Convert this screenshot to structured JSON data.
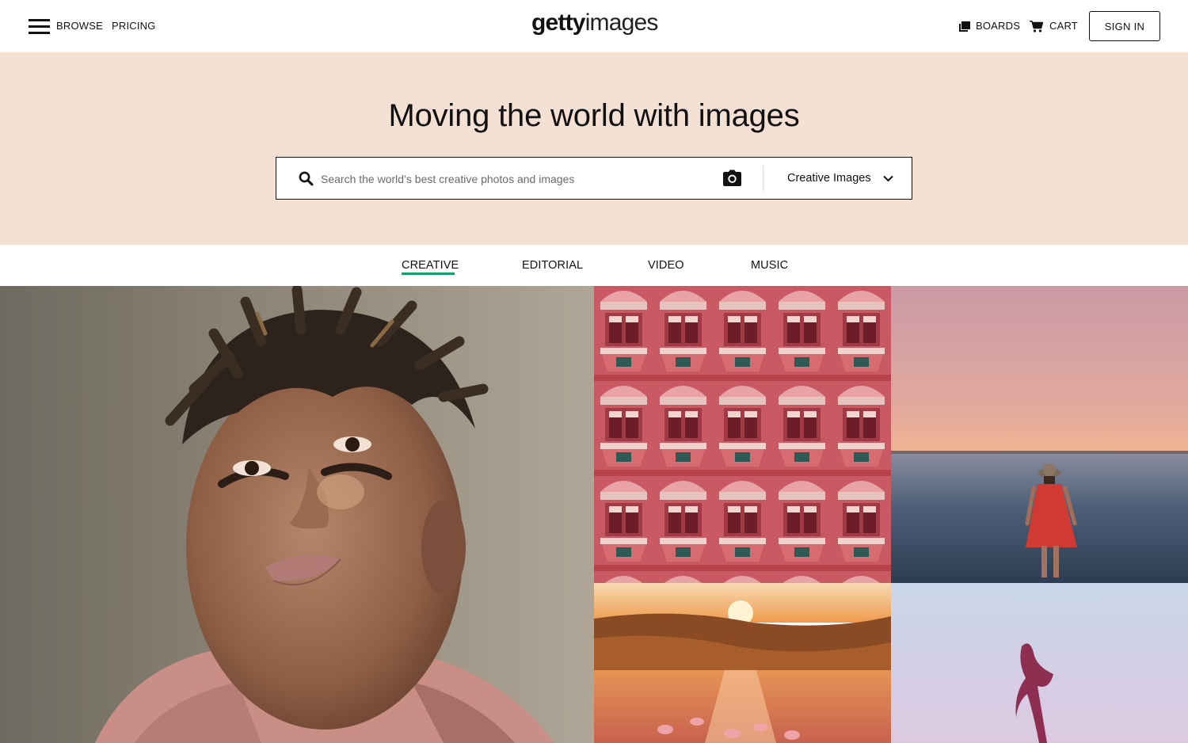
{
  "header": {
    "browse_label": "BROWSE",
    "pricing_label": "PRICING",
    "logo": {
      "bold": "getty",
      "light": "images"
    },
    "boards_label": "BOARDS",
    "cart_label": "CART",
    "signin_label": "SIGN IN"
  },
  "hero": {
    "title": "Moving the world with images",
    "search": {
      "placeholder": "Search the world’s best creative photos and images",
      "value": "",
      "type_selected": "Creative Images"
    },
    "background": "#f4e1d4"
  },
  "tabs": {
    "items": [
      {
        "label": "CREATIVE",
        "active": true
      },
      {
        "label": "EDITORIAL",
        "active": false
      },
      {
        "label": "VIDEO",
        "active": false
      },
      {
        "label": "MUSIC",
        "active": false
      }
    ],
    "active_color": "#0fa36b"
  },
  "icons": {
    "menu": "hamburger-menu-icon",
    "boards": "boards-icon",
    "cart": "cart-icon",
    "search": "search-icon",
    "camera": "camera-icon",
    "dropdown": "chevron-down-icon"
  },
  "gallery": {
    "tiles": [
      {
        "subject": "portrait"
      },
      {
        "subject": "palace"
      },
      {
        "subject": "lake"
      },
      {
        "subject": "flamingo"
      },
      {
        "subject": "sky"
      }
    ]
  }
}
